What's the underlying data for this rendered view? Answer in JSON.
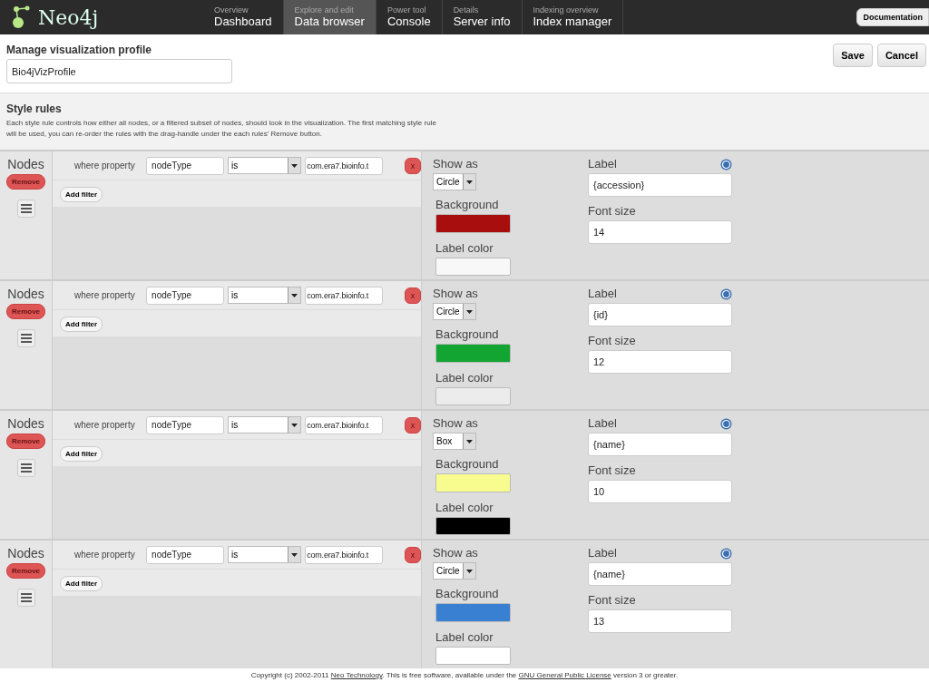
{
  "brand": "Neo4j",
  "nav": [
    {
      "caption": "Overview",
      "label": "Dashboard",
      "selected": false
    },
    {
      "caption": "Explore and edit",
      "label": "Data browser",
      "selected": true
    },
    {
      "caption": "Power tool",
      "label": "Console",
      "selected": false
    },
    {
      "caption": "Details",
      "label": "Server info",
      "selected": false
    },
    {
      "caption": "Indexing overview",
      "label": "Index manager",
      "selected": false
    }
  ],
  "documentation_button": "Documentation",
  "profile": {
    "heading": "Manage visualization profile",
    "name": "Bio4jVizProfile",
    "save": "Save",
    "cancel": "Cancel"
  },
  "style_rules": {
    "heading": "Style rules",
    "description": "Each style rule controls how either all nodes, or a filtered subset of nodes, should look in the visualization. The first matching style rule will be used, you can re-order the rules with the drag-handle under the each rules' Remove button."
  },
  "rules": [
    {
      "target": "Nodes",
      "remove": "Remove",
      "filter": {
        "label": "where property",
        "property": "nodeType",
        "operator": "is",
        "value": "com.era7.bioinfo.t",
        "delete": "x"
      },
      "add_filter": "Add filter",
      "show_as_label": "Show as",
      "show_as": "Circle",
      "background_label": "Background",
      "background": {
        "color": "#a80e0e"
      },
      "label_color_label": "Label color",
      "label_color": {
        "color": "#f8f8f8"
      },
      "label_label": "Label",
      "label": "{accession}",
      "font_size_label": "Font size",
      "font_size": "14"
    },
    {
      "target": "Nodes",
      "remove": "Remove",
      "filter": {
        "label": "where property",
        "property": "nodeType",
        "operator": "is",
        "value": "com.era7.bioinfo.t",
        "delete": "x"
      },
      "add_filter": "Add filter",
      "show_as_label": "Show as",
      "show_as": "Circle",
      "background_label": "Background",
      "background": {
        "color": "#12a532"
      },
      "label_color_label": "Label color",
      "label_color": {
        "color": "#ececec"
      },
      "label_label": "Label",
      "label": "{id}",
      "font_size_label": "Font size",
      "font_size": "12"
    },
    {
      "target": "Nodes",
      "remove": "Remove",
      "filter": {
        "label": "where property",
        "property": "nodeType",
        "operator": "is",
        "value": "com.era7.bioinfo.t",
        "delete": "x"
      },
      "add_filter": "Add filter",
      "show_as_label": "Show as",
      "show_as": "Box",
      "background_label": "Background",
      "background": {
        "color": "#f8fc8e"
      },
      "label_color_label": "Label color",
      "label_color": {
        "color": "#000000"
      },
      "label_label": "Label",
      "label": "{name}",
      "font_size_label": "Font size",
      "font_size": "10"
    },
    {
      "target": "Nodes",
      "remove": "Remove",
      "filter": {
        "label": "where property",
        "property": "nodeType",
        "operator": "is",
        "value": "com.era7.bioinfo.t",
        "delete": "x"
      },
      "add_filter": "Add filter",
      "show_as_label": "Show as",
      "show_as": "Circle",
      "background_label": "Background",
      "background": {
        "color": "#3a80d2"
      },
      "label_color_label": "Label color",
      "label_color": {
        "color": "#ffffff"
      },
      "label_label": "Label",
      "label": "{name}",
      "font_size_label": "Font size",
      "font_size": "13"
    }
  ],
  "footer": {
    "before": "Copyright (c) 2002-2011",
    "link1": "Neo Technology",
    "middle": ". This is free software, available under the",
    "link2": "GNU General Public License",
    "after": "version 3 or greater."
  }
}
